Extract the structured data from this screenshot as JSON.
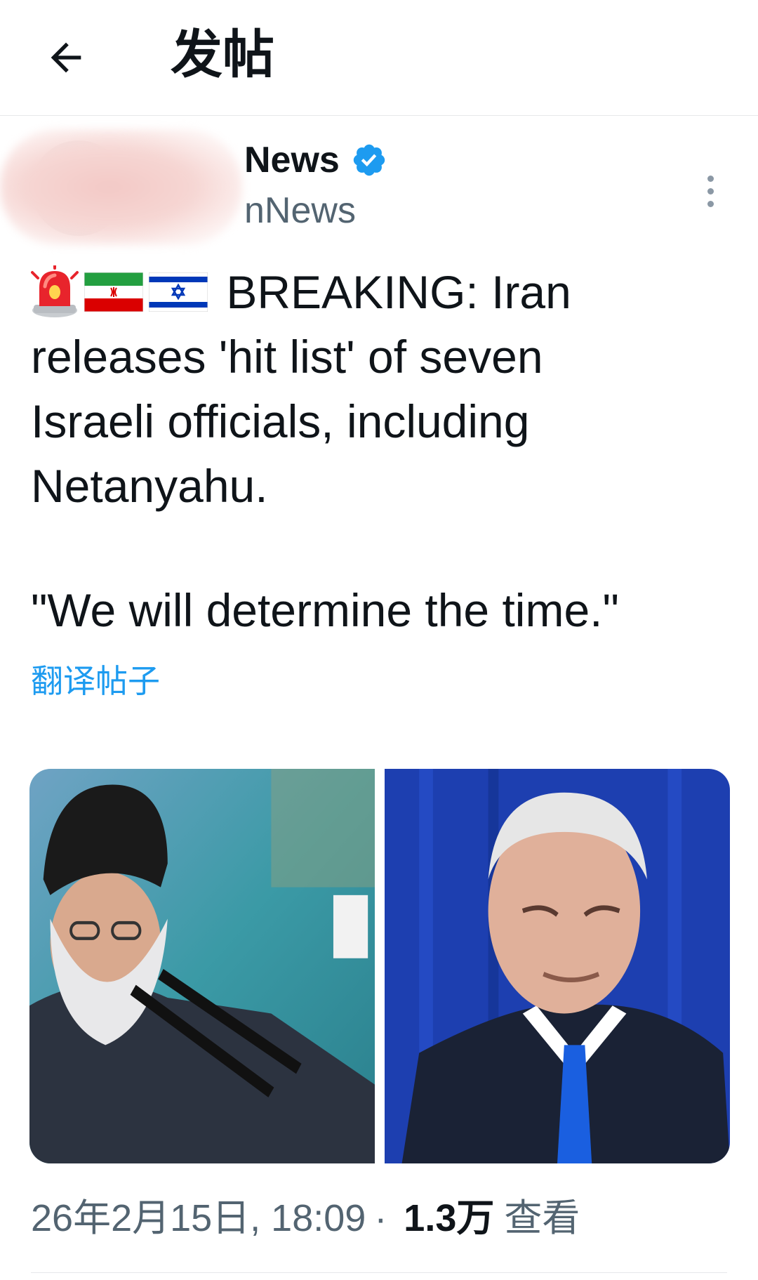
{
  "header": {
    "title": "发帖"
  },
  "author": {
    "display_name": "News",
    "handle": "nNews",
    "verified": true
  },
  "tweet": {
    "emoji": [
      "rotating-light",
      "flag-iran",
      "flag-israel"
    ],
    "lines": [
      "BREAKING: Iran",
      "releases 'hit list' of seven",
      "Israeli officials, including",
      "Netanyahu."
    ],
    "quote": "\"We will determine the time.\"",
    "translate_label": "翻译帖子"
  },
  "media": [
    {
      "name": "photo-cleric-speaking"
    },
    {
      "name": "photo-netanyahu-portrait"
    }
  ],
  "meta": {
    "timestamp": "26年2月15日, 18:09",
    "separator": "·",
    "views_count": "1.3万",
    "views_label": "查看"
  },
  "colors": {
    "link_blue": "#1d9bf0",
    "verified_blue": "#1d9bf0",
    "text_primary": "#0f1419",
    "text_secondary": "#536471"
  }
}
